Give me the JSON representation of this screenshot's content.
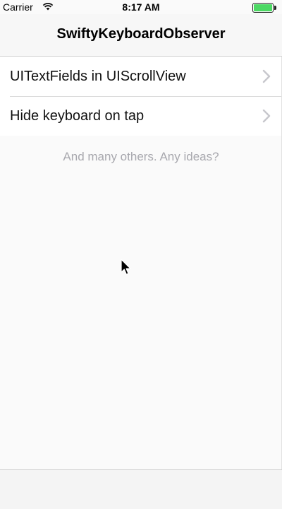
{
  "status_bar": {
    "carrier": "Carrier",
    "time": "8:17 AM",
    "wifi_icon": "wifi-icon",
    "battery_icon": "battery-icon",
    "battery_color": "#4cd964"
  },
  "nav": {
    "title": "SwiftyKeyboardObserver"
  },
  "table": {
    "rows": [
      {
        "label": "UITextFields in UIScrollView",
        "icon": "chevron-right-icon"
      },
      {
        "label": "Hide keyboard on tap",
        "icon": "chevron-right-icon"
      }
    ],
    "footer": "And many others. Any ideas?"
  },
  "colors": {
    "footer_text": "#a8a8ae",
    "chevron": "#c7c7cc",
    "background": "#fafafa"
  }
}
